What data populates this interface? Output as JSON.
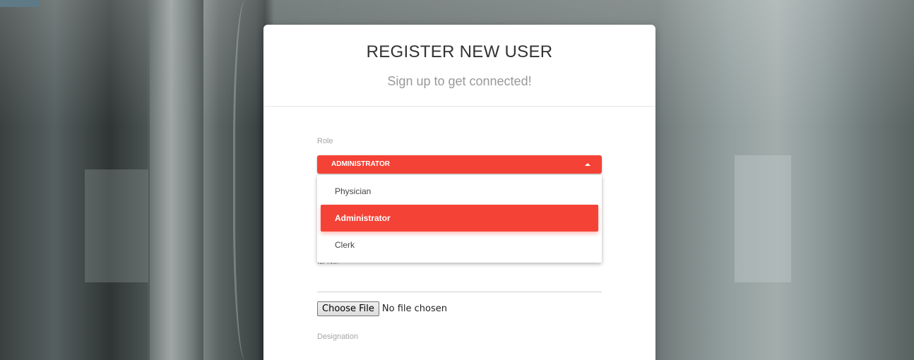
{
  "card": {
    "title": "REGISTER NEW USER",
    "subtitle": "Sign up to get connected!"
  },
  "role": {
    "label": "Role",
    "selected": "ADMINISTRATOR",
    "options": [
      "Physician",
      "Administrator",
      "Clerk"
    ],
    "active_index": 1
  },
  "hidden_field": {
    "label": "ID No."
  },
  "file_upload": {
    "button_label": "Choose File",
    "status": "No file chosen"
  },
  "designation": {
    "label": "Designation"
  },
  "colors": {
    "accent": "#f44336",
    "card_background": "#ffffff"
  },
  "icons": {
    "select_caret": "caret-up-icon"
  }
}
